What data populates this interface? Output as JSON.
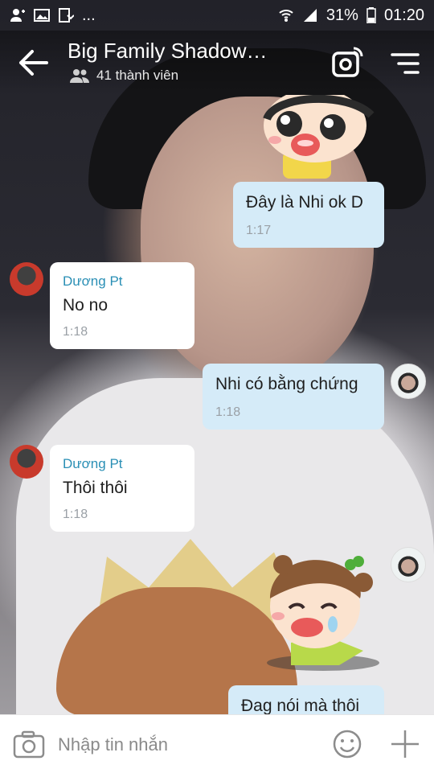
{
  "status_bar": {
    "battery": "31%",
    "time": "01:20",
    "more": "..."
  },
  "header": {
    "title": "Big Family Shadow…",
    "members": "41 thành viên"
  },
  "messages": [
    {
      "sender": "",
      "text": "Đây là Nhi ok D",
      "time": "1:17"
    },
    {
      "sender": "Dương Pt",
      "text": "No no",
      "time": "1:18"
    },
    {
      "sender": "",
      "text": "Nhi có bằng chứng",
      "time": "1:18"
    },
    {
      "sender": "Dương Pt",
      "text": "Thôi thôi",
      "time": "1:18"
    },
    {
      "sender": "",
      "text": "Đag nói mà thôi",
      "time": ""
    }
  ],
  "input": {
    "placeholder": "Nhập tin nhắn"
  },
  "colors": {
    "my_bubble": "#d5ebf8",
    "their_bubble": "#ffffff",
    "sender_name": "#2a8fb5"
  }
}
